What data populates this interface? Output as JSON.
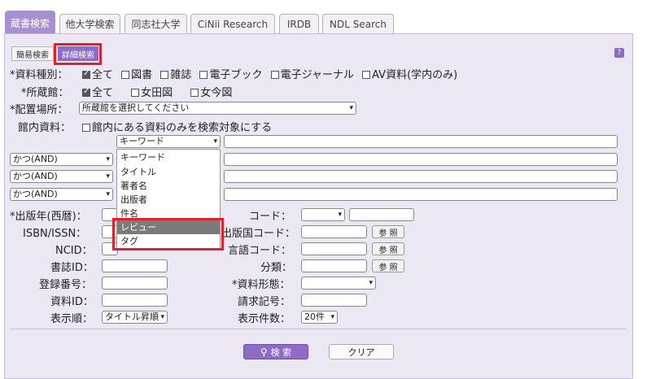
{
  "tabs": [
    "蔵書検索",
    "他大学検索",
    "同志社大学",
    "CiNii Research",
    "IRDB",
    "NDL Search"
  ],
  "mode": {
    "simple": "簡易検索",
    "advanced": "詳細検索",
    "help": "?"
  },
  "material_type": {
    "label": "*資料種別：",
    "options": [
      "全て",
      "図書",
      "雑誌",
      "電子ブック",
      "電子ジャーナル",
      "AV資料(学内のみ)"
    ]
  },
  "library": {
    "label": "*所蔵館：",
    "options": [
      "全て",
      "女田図",
      "女今図"
    ]
  },
  "location": {
    "label": "*配置場所：",
    "placeholder": "所蔵館を選択してください"
  },
  "in_library": {
    "label": "館内資料：",
    "option": "館内にある資料のみを検索対象にする"
  },
  "keyword_row": {
    "field": "キーワード"
  },
  "operators": [
    "かつ(AND)",
    "かつ(AND)",
    "かつ(AND)"
  ],
  "dropdown_options": [
    "キーワード",
    "タイトル",
    "著者名",
    "出版者",
    "件名",
    "レビュー",
    "タグ"
  ],
  "left_fields": [
    "*出版年(西暦)：",
    "ISBN/ISSN：",
    "NCID：",
    "書誌ID：",
    "登録番号：",
    "資料ID：",
    "表示順："
  ],
  "right_fields": [
    "コード：",
    "出版国コード：",
    "言語コード：",
    "分類：",
    "*資料形態：",
    "請求記号：",
    "表示件数："
  ],
  "ref_button": "参 照",
  "sort_value": "タイトル昇順",
  "count_value": "20件",
  "search_button": "検 索",
  "clear_button": "クリア"
}
